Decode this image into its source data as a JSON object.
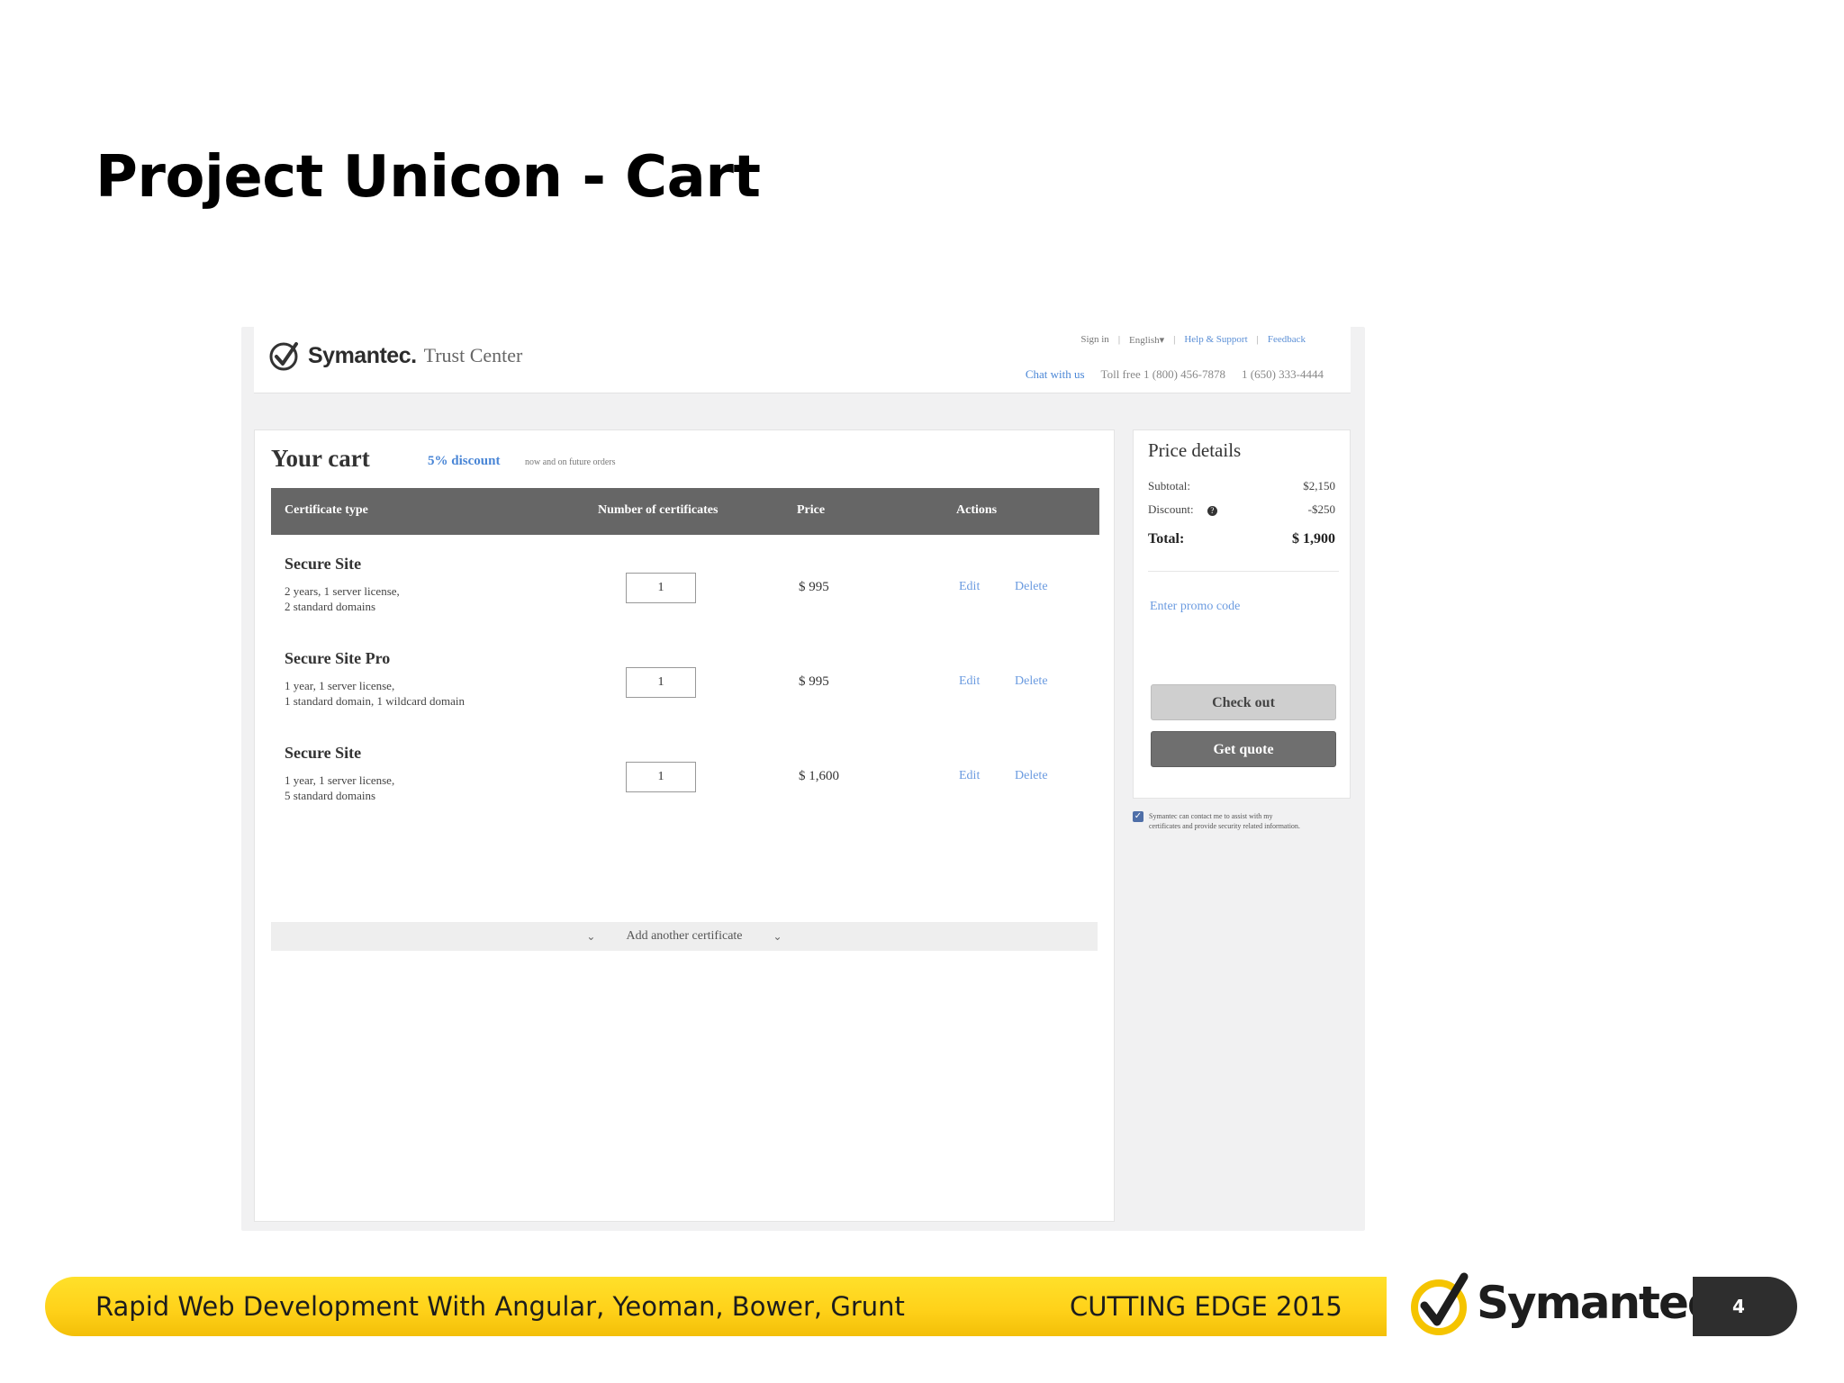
{
  "slide": {
    "title": "Project Unicon - Cart"
  },
  "site": {
    "brand_name": "Symantec.",
    "brand_sub": "Trust Center",
    "top_links": {
      "sign_in": "Sign in",
      "language": "English▾",
      "help": "Help & Support",
      "feedback": "Feedback"
    },
    "contact": {
      "chat": "Chat with us",
      "toll_free": "Toll free 1 (800) 456-7878",
      "phone": "1 (650) 333-4444"
    }
  },
  "cart": {
    "title": "Your cart",
    "discount": "5% discount",
    "discount_note": "now and on future orders",
    "columns": {
      "type": "Certificate type",
      "number": "Number of certificates",
      "price": "Price",
      "actions": "Actions"
    },
    "rows": [
      {
        "name": "Secure Site",
        "desc_line1": "2 years, 1 server license,",
        "desc_line2": "2 standard domains",
        "qty": "1",
        "price": "$ 995",
        "edit": "Edit",
        "delete": "Delete"
      },
      {
        "name": "Secure Site Pro",
        "desc_line1": "1 year, 1 server license,",
        "desc_line2": "1 standard domain, 1 wildcard domain",
        "qty": "1",
        "price": "$ 995",
        "edit": "Edit",
        "delete": "Delete"
      },
      {
        "name": "Secure Site",
        "desc_line1": "1 year, 1 server license,",
        "desc_line2": "5 standard domains",
        "qty": "1",
        "price": "$ 1,600",
        "edit": "Edit",
        "delete": "Delete"
      }
    ],
    "add_another": "Add another certificate"
  },
  "price_details": {
    "title": "Price details",
    "subtotal_label": "Subtotal:",
    "subtotal_value": "$2,150",
    "discount_label": "Discount:",
    "discount_value": "-$250",
    "total_label": "Total:",
    "total_value": "$ 1,900",
    "promo": "Enter promo code",
    "checkout": "Check out",
    "quote": "Get quote",
    "consent_line1": "Symantec can contact me to assist with my",
    "consent_line2": "certificates and provide security related information."
  },
  "footer": {
    "left": "Rapid Web Development With Angular, Yeoman, Bower, Grunt",
    "right": "CUTTING EDGE 2015",
    "logo_text": "Symantec.",
    "page": "4"
  },
  "colors": {
    "accent_link": "#4a86d6",
    "header_bar": "#666666",
    "footer_yellow": "#ffd21a",
    "badge_dark": "#2e2e2e"
  }
}
